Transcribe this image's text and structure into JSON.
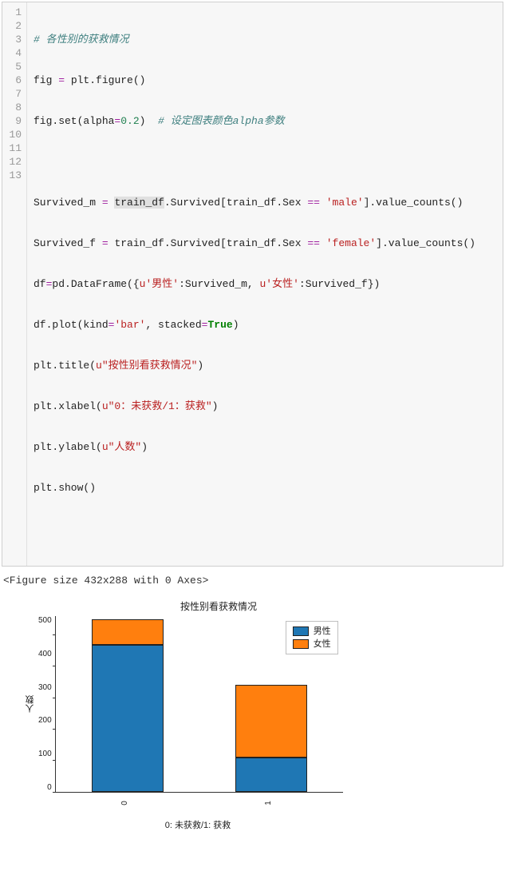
{
  "code": {
    "lines": {
      "l1": "# 各性别的获救情况",
      "l2a": "fig ",
      "l2b": "=",
      "l2c": " plt",
      "l2d": ".figure()",
      "l3a": "fig",
      "l3b": ".set(alpha",
      "l3c": "=",
      "l3d": "0.2",
      "l3e": ")  ",
      "l3f": "# 设定图表颜色alpha参数",
      "l5a": "Survived_m ",
      "l5b": "=",
      "l5c": " ",
      "l5d": "train_df",
      "l5e": ".Survived[train_df",
      "l5f": ".Sex ",
      "l5g": "==",
      "l5h": " ",
      "l5i": "'male'",
      "l5j": "]",
      "l5k": ".value_counts()",
      "l6a": "Survived_f ",
      "l6b": "=",
      "l6c": " train_df",
      "l6d": ".Survived[train_df",
      "l6e": ".Sex ",
      "l6f": "==",
      "l6g": " ",
      "l6h": "'female'",
      "l6i": "]",
      "l6j": ".value_counts()",
      "l7a": "df",
      "l7b": "=",
      "l7c": "pd",
      "l7d": ".DataFrame({",
      "l7e": "u'男性'",
      "l7f": ":Survived_m, ",
      "l7g": "u'女性'",
      "l7h": ":Survived_f})",
      "l8a": "df",
      "l8b": ".plot(kind",
      "l8c": "=",
      "l8d": "'bar'",
      "l8e": ", stacked",
      "l8f": "=",
      "l8g": "True",
      "l8h": ")",
      "l9a": "plt",
      "l9b": ".title(",
      "l9c": "u\"按性别看获救情况\"",
      "l9d": ")",
      "l10a": "plt",
      "l10b": ".xlabel(",
      "l10c": "u\"0：未获救/1：获救\"",
      "l10d": ")",
      "l11a": "plt",
      "l11b": ".ylabel(",
      "l11c": "u\"人数\"",
      "l11d": ")",
      "l12a": "plt",
      "l12b": ".show()"
    },
    "line_numbers": [
      "1",
      "2",
      "3",
      "4",
      "5",
      "6",
      "7",
      "8",
      "9",
      "10",
      "11",
      "12",
      "13"
    ]
  },
  "output_text": "<Figure size 432x288 with 0 Axes>",
  "chart_data": {
    "type": "bar",
    "stacked": true,
    "title": "按性别看获救情况",
    "xlabel": "0: 未获救/1: 获救",
    "ylabel": "人数",
    "categories": [
      "0",
      "1"
    ],
    "series": [
      {
        "name": "男性",
        "color": "#1f77b4",
        "values": [
          468,
          109
        ]
      },
      {
        "name": "女性",
        "color": "#ff7f0e",
        "values": [
          81,
          233
        ]
      }
    ],
    "yticks": [
      "0",
      "100",
      "200",
      "300",
      "400",
      "500"
    ],
    "ylim": [
      0,
      560
    ]
  }
}
